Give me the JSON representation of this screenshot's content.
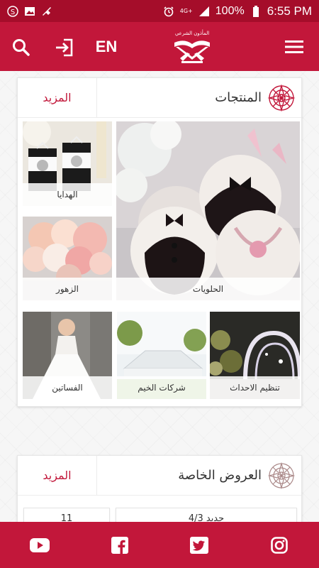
{
  "status_bar": {
    "time": "6:55 PM",
    "battery_pct": "100%",
    "network": "4G+",
    "icons": [
      "s-app-icon",
      "image-icon",
      "mute-icon",
      "alarm-icon",
      "signal-icon",
      "battery-icon"
    ]
  },
  "header": {
    "lang_label": "EN",
    "logo_text": "المأذون الشرعي",
    "icons": [
      "search-icon",
      "login-icon",
      "hamburger-menu-icon"
    ]
  },
  "products": {
    "title": "المنتجات",
    "more_label": "المزيد",
    "tiles": [
      {
        "label": "الحلويات",
        "key": "sweets"
      },
      {
        "label": "الهدايا",
        "key": "gifts"
      },
      {
        "label": "الزهور",
        "key": "flowers"
      },
      {
        "label": "تنظيم الاحداث",
        "key": "events"
      },
      {
        "label": "شركات الخيم",
        "key": "tents"
      },
      {
        "label": "الفساتين",
        "key": "dresses"
      }
    ]
  },
  "offers": {
    "title": "العروض الخاصة",
    "more_label": "المزيد",
    "items": [
      {
        "label": "جديد 4/3"
      },
      {
        "label": "11"
      }
    ]
  },
  "footer": {
    "icons": [
      "youtube-icon",
      "facebook-icon",
      "twitter-icon",
      "instagram-icon"
    ]
  },
  "colors": {
    "brand_red": "#c2173a",
    "status_red": "#a50d2a"
  }
}
